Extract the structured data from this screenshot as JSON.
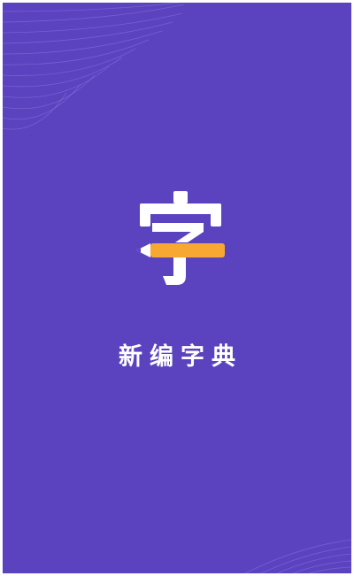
{
  "splash": {
    "logo_glyph": "字",
    "logo_icon": "pencil-character-icon",
    "app_name": "新编字典"
  },
  "colors": {
    "background": "#5b43c0",
    "accent": "#f6a833",
    "pencil_tip": "#ffffff"
  }
}
